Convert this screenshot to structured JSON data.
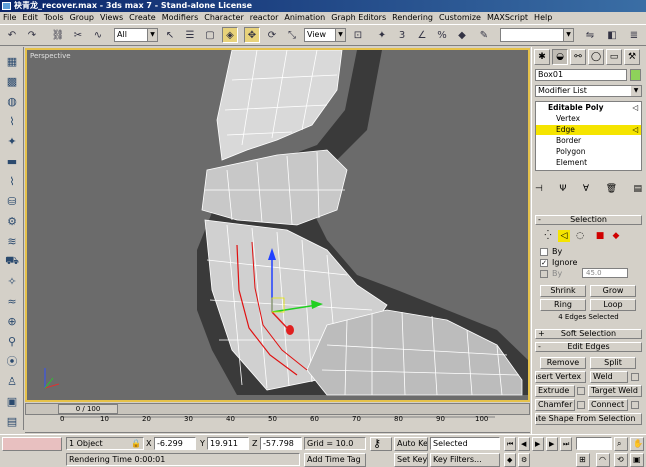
{
  "window": {
    "title": "袂青龙_recover.max - 3ds max 7  - Stand-alone License"
  },
  "menu": [
    "File",
    "Edit",
    "Tools",
    "Group",
    "Views",
    "Create",
    "Modifiers",
    "Character",
    "reactor",
    "Animation",
    "Graph Editors",
    "Rendering",
    "Customize",
    "MAXScript",
    "Help"
  ],
  "toolbar": {
    "selection_filter": "All",
    "ref_coord": "View",
    "named_selection": ""
  },
  "viewport": {
    "label": "Perspective"
  },
  "time_slider": {
    "frame_text": "0 / 100"
  },
  "trackbar": {
    "ticks": [
      "0",
      "10",
      "20",
      "30",
      "40",
      "50",
      "60",
      "70",
      "80",
      "90",
      "100"
    ]
  },
  "status": {
    "selection_count": "1 Object",
    "x_label": "X",
    "x_value": "-6.299",
    "y_label": "Y",
    "y_value": "19.911",
    "z_label": "Z",
    "z_value": "-57.798",
    "grid": "Grid = 10.0",
    "auto_key": "Auto Key",
    "set_key": "Set Key",
    "key_mode": "Selected",
    "key_filters": "Key Filters...",
    "prompt": "Rendering Time  0:00:01",
    "add_time_tag": "Add Time Tag"
  },
  "command_panel": {
    "object_name": "Box01",
    "modifier_list": "Modifier List",
    "stack": {
      "root": "Editable Poly",
      "items": [
        "Vertex",
        "Edge",
        "Border",
        "Polygon",
        "Element"
      ],
      "selected_index": 1
    },
    "selection_rollout": {
      "title": "Selection",
      "by_label": "By",
      "ignore_label": "Ignore",
      "by_angle_label": "By",
      "angle_value": "45.0",
      "shrink": "Shrink",
      "grow": "Grow",
      "ring": "Ring",
      "loop": "Loop",
      "info": "4 Edges Selected"
    },
    "soft_selection_rollout": {
      "title": "Soft Selection"
    },
    "edit_edges_rollout": {
      "title": "Edit Edges",
      "remove": "Remove",
      "split": "Split",
      "insert_vertex": "Insert Vertex",
      "weld": "Weld",
      "extrude": "Extrude",
      "target_weld": "Target Weld",
      "chamfer": "Chamfer",
      "connect": "Connect",
      "create_shape": "Create Shape From Selection"
    }
  },
  "colors": {
    "viewport_bg": "#6b6b6b",
    "active_border": "#e6c24a",
    "selected_edges": "#e01010"
  }
}
